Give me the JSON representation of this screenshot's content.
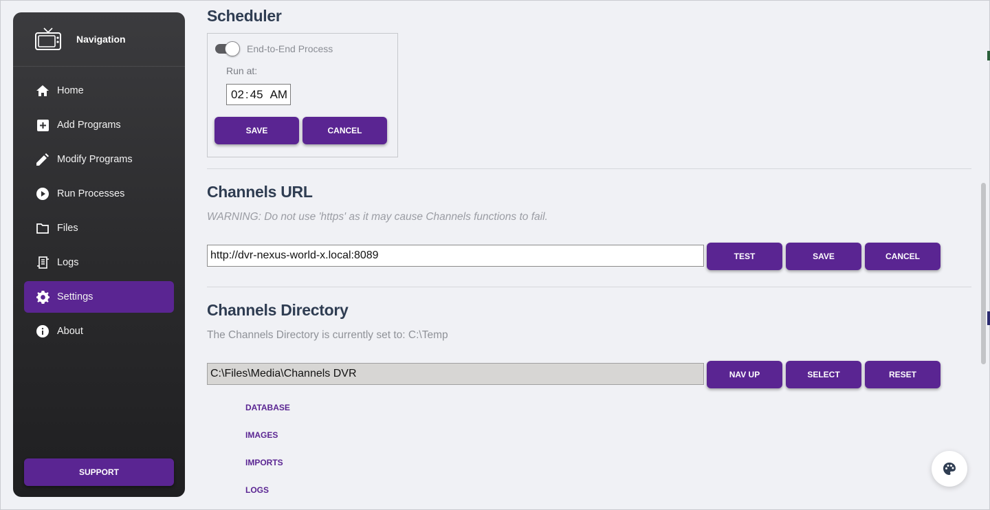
{
  "sidebar": {
    "title": "Navigation",
    "items": [
      {
        "label": "Home",
        "icon": "home-icon"
      },
      {
        "label": "Add Programs",
        "icon": "add-box-icon"
      },
      {
        "label": "Modify Programs",
        "icon": "pencil-icon"
      },
      {
        "label": "Run Processes",
        "icon": "play-circle-icon"
      },
      {
        "label": "Files",
        "icon": "folder-icon"
      },
      {
        "label": "Logs",
        "icon": "receipt-icon"
      },
      {
        "label": "Settings",
        "icon": "gear-icon",
        "active": true
      },
      {
        "label": "About",
        "icon": "info-icon"
      }
    ],
    "support_label": "SUPPORT"
  },
  "scheduler": {
    "title": "Scheduler",
    "toggle_label": "End-to-End Process",
    "toggle_on": true,
    "run_at_label": "Run at:",
    "hour": "02",
    "minute": "45",
    "ampm": "AM",
    "save_label": "SAVE",
    "cancel_label": "CANCEL"
  },
  "channels_url": {
    "title": "Channels URL",
    "warning": "WARNING: Do not use 'https' as it may cause Channels functions to fail.",
    "value": "http://dvr-nexus-world-x.local:8089",
    "test_label": "TEST",
    "save_label": "SAVE",
    "cancel_label": "CANCEL"
  },
  "channels_directory": {
    "title": "Channels Directory",
    "description": "The Channels Directory is currently set to: C:\\Temp",
    "path": "C:\\Files\\Media\\Channels DVR",
    "nav_up_label": "NAV UP",
    "select_label": "SELECT",
    "reset_label": "RESET",
    "subfolders": [
      "DATABASE",
      "IMAGES",
      "IMPORTS",
      "LOGS"
    ]
  },
  "colors": {
    "accent": "#5a2592",
    "sidebar_bg": "#2b2b2d",
    "page_bg": "#f0f1f5"
  },
  "fab": {
    "icon": "palette-icon"
  }
}
